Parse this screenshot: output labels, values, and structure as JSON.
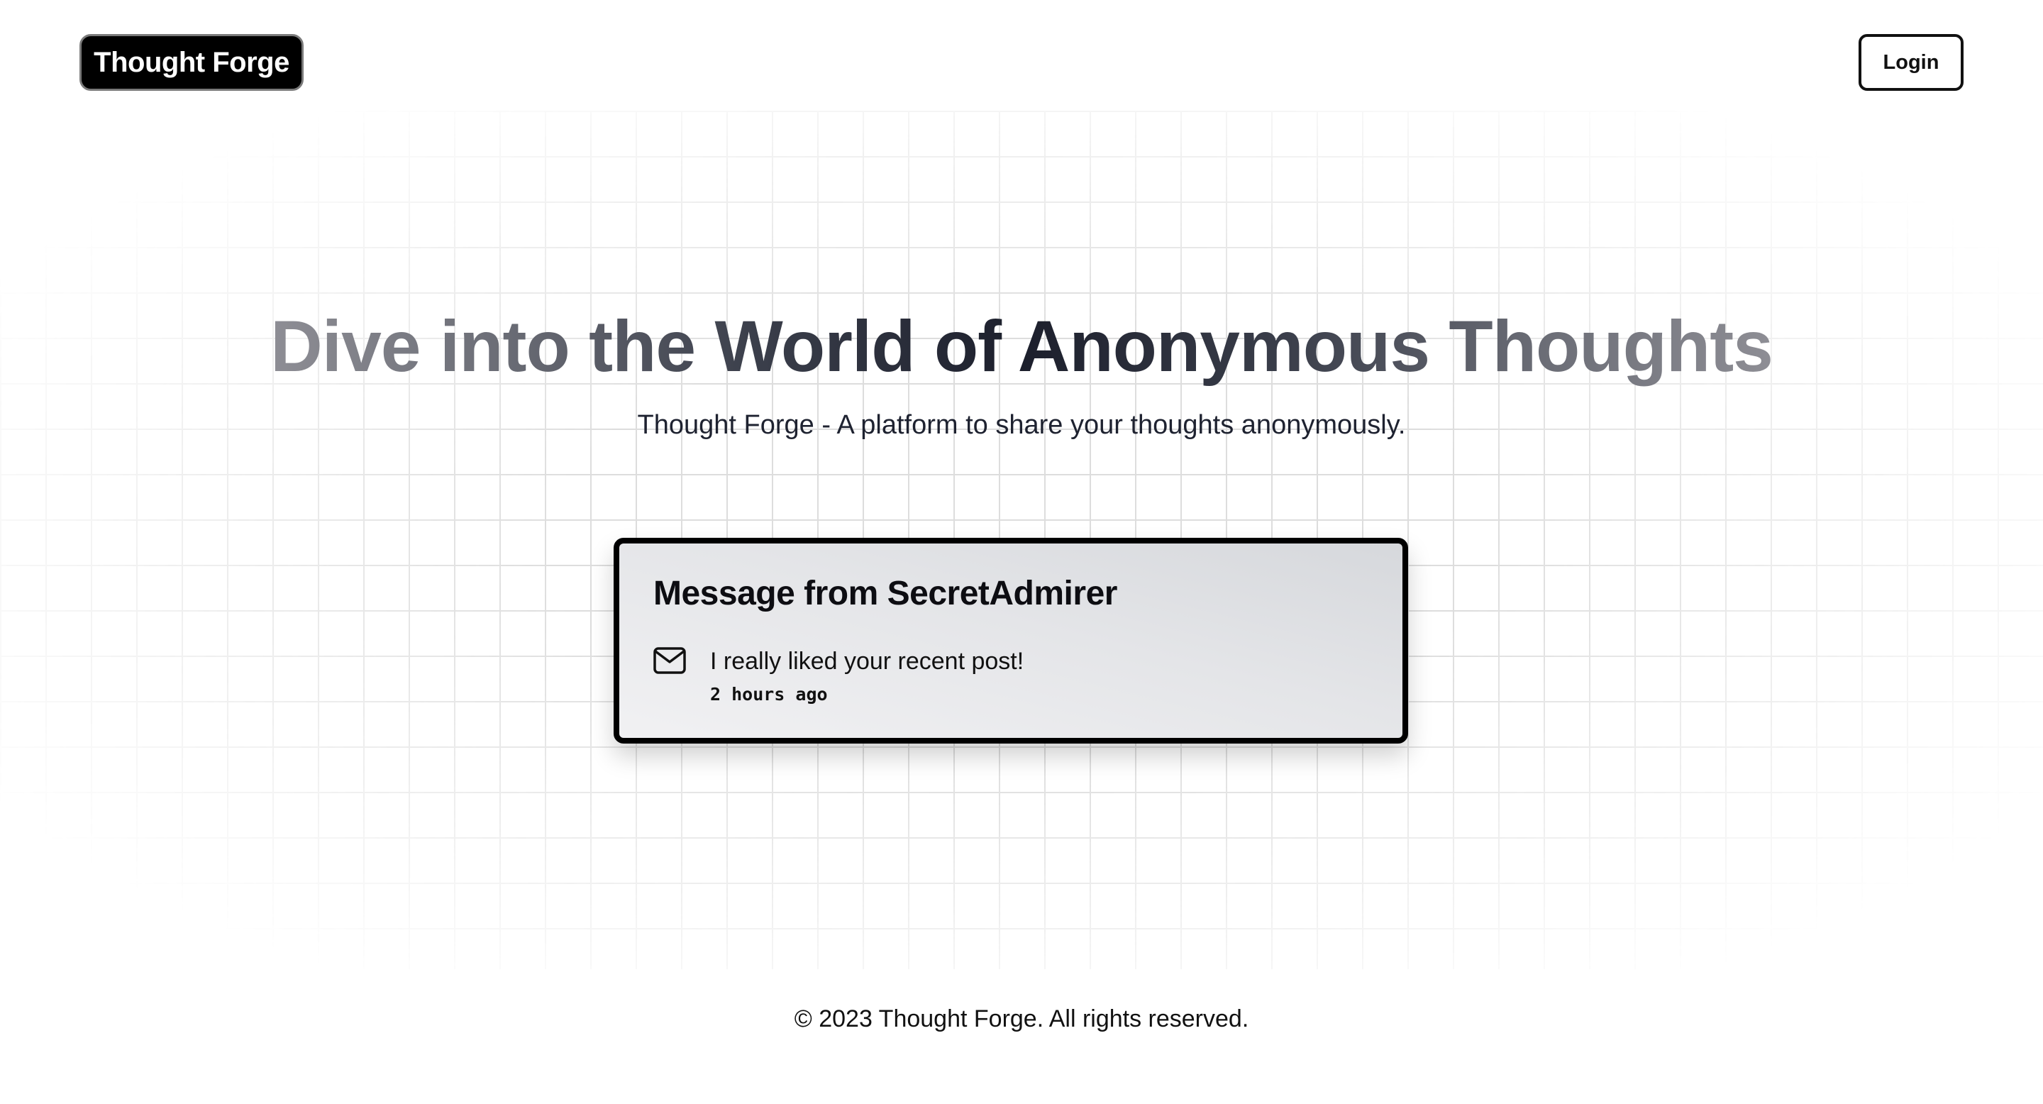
{
  "header": {
    "brand": "Thought Forge",
    "login_label": "Login"
  },
  "hero": {
    "title": "Dive into the World of Anonymous Thoughts",
    "subtitle": "Thought Forge - A platform to share your thoughts anonymously."
  },
  "message_card": {
    "title": "Message from SecretAdmirer",
    "icon": "mail-icon",
    "content": "I really liked your recent post!",
    "received": "2 hours ago"
  },
  "footer": {
    "copyright": "© 2023 Thought Forge. All rights reserved."
  },
  "colors": {
    "background": "#ffffff",
    "brand_bg": "#000000",
    "brand_text": "#ffffff",
    "card_border": "#000000",
    "grid_line": "#d8d8d8",
    "title_center": "#1c1f2c",
    "title_edge": "#8d8d94"
  }
}
